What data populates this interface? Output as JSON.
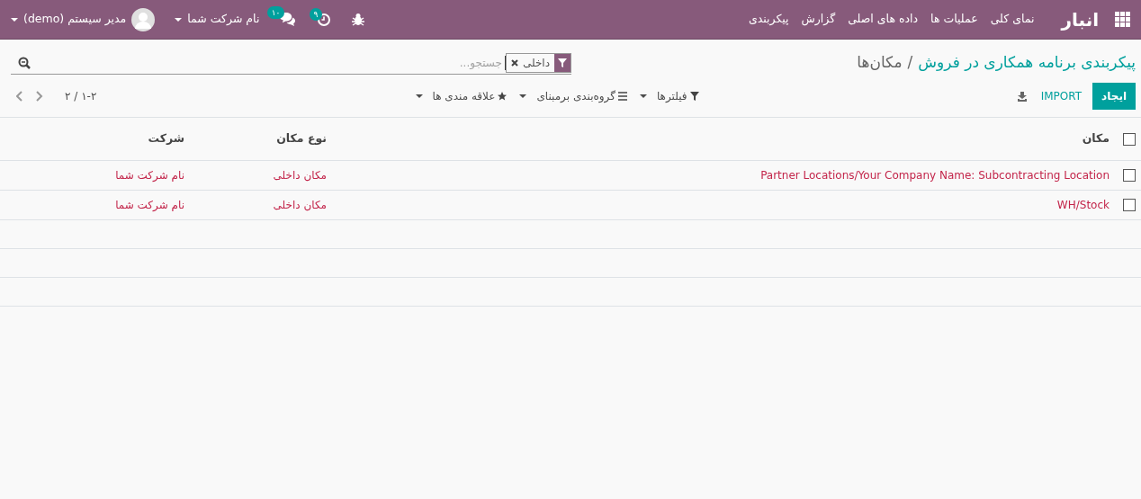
{
  "navbar": {
    "app_title": "انبار",
    "menu": [
      "نمای کلی",
      "عملیات ها",
      "داده های اصلی",
      "گزارش",
      "پیکربندی"
    ],
    "activity_count": "۹",
    "messages_count": "۱۰",
    "company": "نام شرکت شما",
    "user": "مدیر سیستم (demo)"
  },
  "breadcrumb_separator": "/",
  "breadcrumb": [
    {
      "label": "پیکربندی برنامه همکاری در فروش",
      "link": true
    },
    {
      "label": "مکان‌ها",
      "link": false
    }
  ],
  "search": {
    "facet": "داخلی",
    "placeholder": "جستجو..."
  },
  "buttons": {
    "create": "ایجاد",
    "import": "IMPORT"
  },
  "filters": [
    "فیلترها",
    "گروه‌بندی برمبنای",
    "علاقه مندی ها"
  ],
  "pager": {
    "value": "۱-۲ / ۲"
  },
  "table": {
    "select_all": {
      "checked": false
    },
    "columns": [
      "مکان",
      "نوع مکان",
      "شرکت"
    ],
    "rows": [
      {
        "checked": false,
        "cells": [
          "Partner Locations/Your Company Name: Subcontracting Location",
          "مکان داخلی",
          "نام شرکت شما"
        ]
      },
      {
        "checked": false,
        "cells": [
          "WH/Stock",
          "مکان داخلی",
          "نام شرکت شما"
        ]
      }
    ]
  }
}
